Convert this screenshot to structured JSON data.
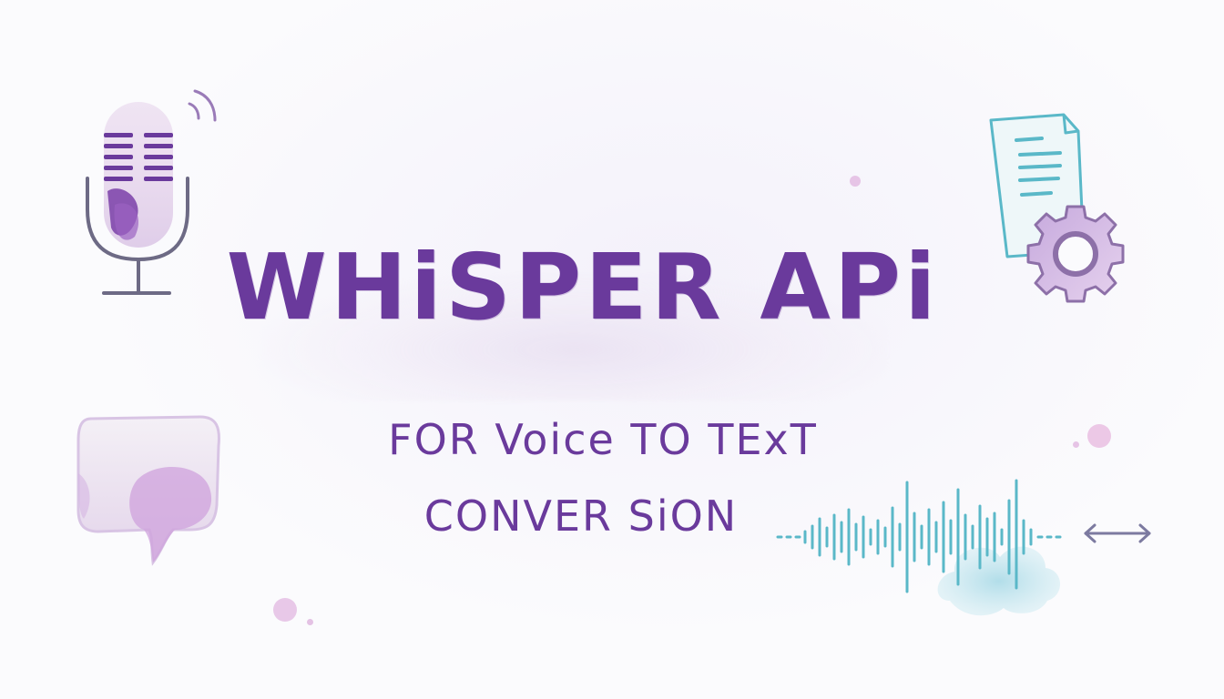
{
  "title": "WHiSPER APi",
  "subtitle_line1": "FOR Voice TO TExT",
  "subtitle_line2": "CONVER SiON",
  "colors": {
    "primary_purple": "#6a3a9c",
    "light_purple": "#c9a8dc",
    "teal": "#5ab8c8",
    "slate": "#6d6a85",
    "background": "#fbfbfd"
  },
  "icons": [
    "microphone-icon",
    "sound-waves-icon",
    "document-icon",
    "gear-icon",
    "speech-bubble-icon",
    "audio-waveform-icon",
    "double-arrow-icon"
  ]
}
